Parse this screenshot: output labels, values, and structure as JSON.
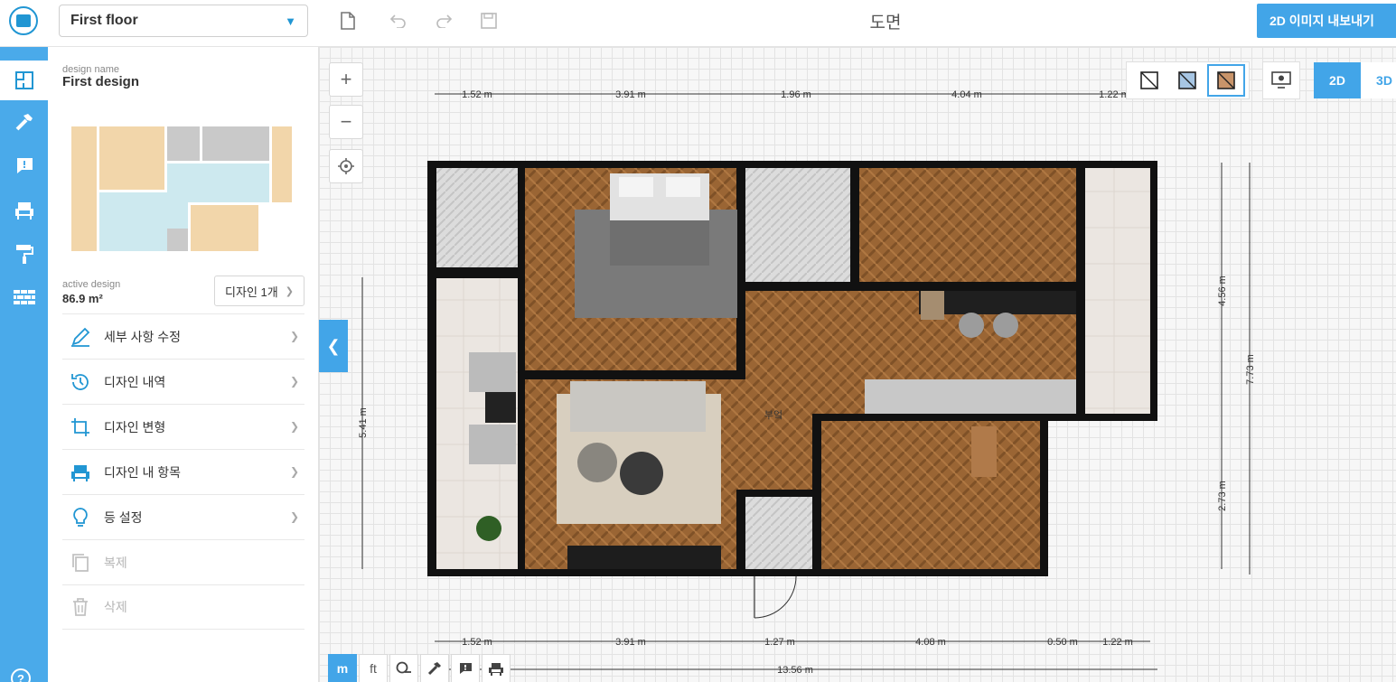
{
  "header": {
    "floor_select": "First floor",
    "page_title": "도면",
    "export_label": "2D 이미지 내보내기"
  },
  "sidebar": {
    "design_name_label": "design name",
    "design_name": "First design",
    "active_design_label": "active design",
    "active_design_area": "86.9 m²",
    "design_count_label": "디자인 1개",
    "menu": [
      {
        "label": "세부 사항 수정",
        "icon": "pencil-icon",
        "enabled": true
      },
      {
        "label": "디자인 내역",
        "icon": "history-icon",
        "enabled": true
      },
      {
        "label": "디자인 변형",
        "icon": "crop-icon",
        "enabled": true
      },
      {
        "label": "디자인 내 항목",
        "icon": "armchair-icon",
        "enabled": true
      },
      {
        "label": "등 설정",
        "icon": "lightbulb-icon",
        "enabled": true
      },
      {
        "label": "복제",
        "icon": "copy-icon",
        "enabled": false
      },
      {
        "label": "삭제",
        "icon": "trash-icon",
        "enabled": false
      }
    ]
  },
  "canvas": {
    "mode_2d": "2D",
    "mode_3d": "3D",
    "room_label": "부엌",
    "top_dimensions": [
      "1.52 m",
      "3.91 m",
      "1.96 m",
      "4.04 m",
      "1.22 m"
    ],
    "bottom_dimensions": [
      "1.52 m",
      "3.91 m",
      "1.27 m",
      "4.08 m",
      "0.50 m",
      "1.22 m"
    ],
    "total_width": "13.56 m",
    "left_dimension": "5.41 m",
    "right_dimensions": [
      "4.56 m",
      "2.73 m"
    ],
    "right_total": "7.73 m",
    "units": [
      "m",
      "ft"
    ]
  },
  "colors": {
    "accent": "#42a5e8",
    "rail": "#4aaaea",
    "wall": "#111111",
    "wood": "#9a6a3a",
    "tile": "#d6d6d6"
  }
}
